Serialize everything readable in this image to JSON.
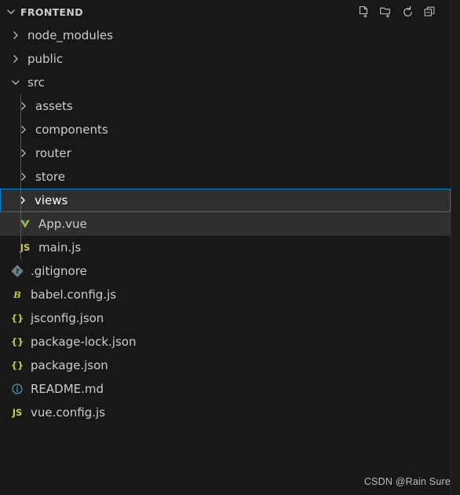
{
  "header": {
    "title": "FRONTEND",
    "twisty_icon": "chevron-down-icon",
    "actions": [
      {
        "name": "new-file-button",
        "icon": "new-file-icon",
        "tooltip": "New File"
      },
      {
        "name": "new-folder-button",
        "icon": "new-folder-icon",
        "tooltip": "New Folder"
      },
      {
        "name": "refresh-button",
        "icon": "refresh-icon",
        "tooltip": "Refresh Explorer"
      },
      {
        "name": "collapse-all-button",
        "icon": "collapse-all-icon",
        "tooltip": "Collapse Folders in Explorer"
      }
    ]
  },
  "colors": {
    "background": "#181818",
    "row_shaded": "#2f2f2f",
    "focus_border": "#0a7aca",
    "text": "#cccccc",
    "text_focused": "#ffffff",
    "chevron": "#c5c5c5",
    "indent_guide": "#585858",
    "js_yellow": "#cbcb41",
    "vue_green": "#8dc149",
    "info_blue": "#519aba",
    "git_gray": "#6d8086"
  },
  "tree": [
    {
      "label": "node_modules",
      "type": "folder",
      "depth": 1,
      "expanded": false,
      "icon": "chevron-right-icon",
      "state": "normal"
    },
    {
      "label": "public",
      "type": "folder",
      "depth": 1,
      "expanded": false,
      "icon": "chevron-right-icon",
      "state": "normal"
    },
    {
      "label": "src",
      "type": "folder",
      "depth": 1,
      "expanded": true,
      "icon": "chevron-down-icon",
      "state": "normal"
    },
    {
      "label": "assets",
      "type": "folder",
      "depth": 2,
      "expanded": false,
      "icon": "chevron-right-icon",
      "state": "normal"
    },
    {
      "label": "components",
      "type": "folder",
      "depth": 2,
      "expanded": false,
      "icon": "chevron-right-icon",
      "state": "normal"
    },
    {
      "label": "router",
      "type": "folder",
      "depth": 2,
      "expanded": false,
      "icon": "chevron-right-icon",
      "state": "normal"
    },
    {
      "label": "store",
      "type": "folder",
      "depth": 2,
      "expanded": false,
      "icon": "chevron-right-icon",
      "state": "normal"
    },
    {
      "label": "views",
      "type": "folder",
      "depth": 2,
      "expanded": false,
      "icon": "chevron-right-icon",
      "state": "focused"
    },
    {
      "label": "App.vue",
      "type": "file",
      "depth": 2,
      "icon": "vue-file-icon",
      "state": "shaded"
    },
    {
      "label": "main.js",
      "type": "file",
      "depth": 2,
      "icon": "js-file-icon",
      "state": "normal"
    },
    {
      "label": ".gitignore",
      "type": "file",
      "depth": 1,
      "icon": "git-file-icon",
      "state": "normal"
    },
    {
      "label": "babel.config.js",
      "type": "file",
      "depth": 1,
      "icon": "babel-file-icon",
      "state": "normal"
    },
    {
      "label": "jsconfig.json",
      "type": "file",
      "depth": 1,
      "icon": "json-file-icon",
      "state": "normal"
    },
    {
      "label": "package-lock.json",
      "type": "file",
      "depth": 1,
      "icon": "json-file-icon",
      "state": "normal"
    },
    {
      "label": "package.json",
      "type": "file",
      "depth": 1,
      "icon": "json-file-icon",
      "state": "normal"
    },
    {
      "label": "README.md",
      "type": "file",
      "depth": 1,
      "icon": "readme-file-icon",
      "state": "normal"
    },
    {
      "label": "vue.config.js",
      "type": "file",
      "depth": 1,
      "icon": "js-file-icon",
      "state": "normal"
    }
  ],
  "watermark": {
    "text": "CSDN @Rain Sure"
  }
}
